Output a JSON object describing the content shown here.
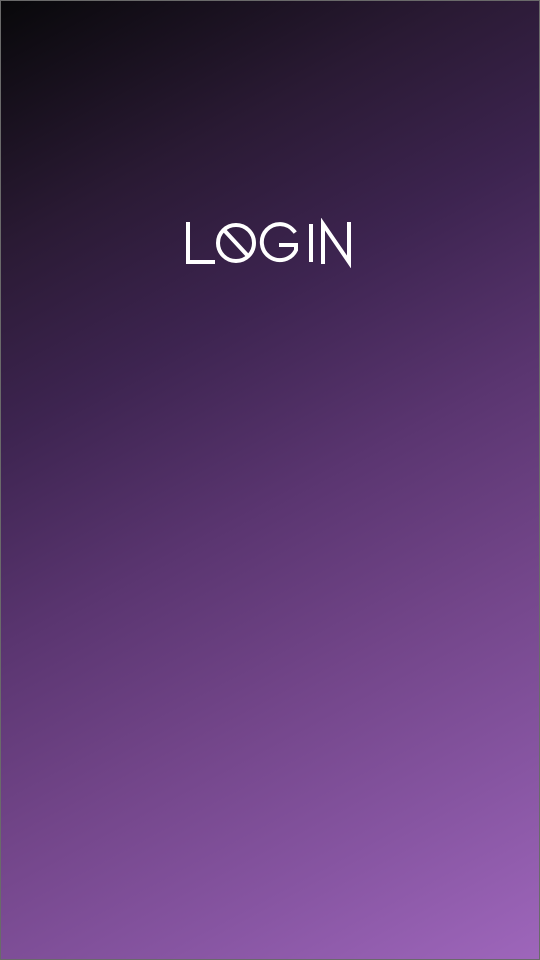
{
  "screen": {
    "title": "LOGIN",
    "logo_icon": "login-wordmark-with-slashed-o"
  },
  "colors": {
    "gradient_start": "#08080a",
    "gradient_mid": "#5a3570",
    "gradient_end": "#9e66bb",
    "logo": "#ffffff"
  }
}
